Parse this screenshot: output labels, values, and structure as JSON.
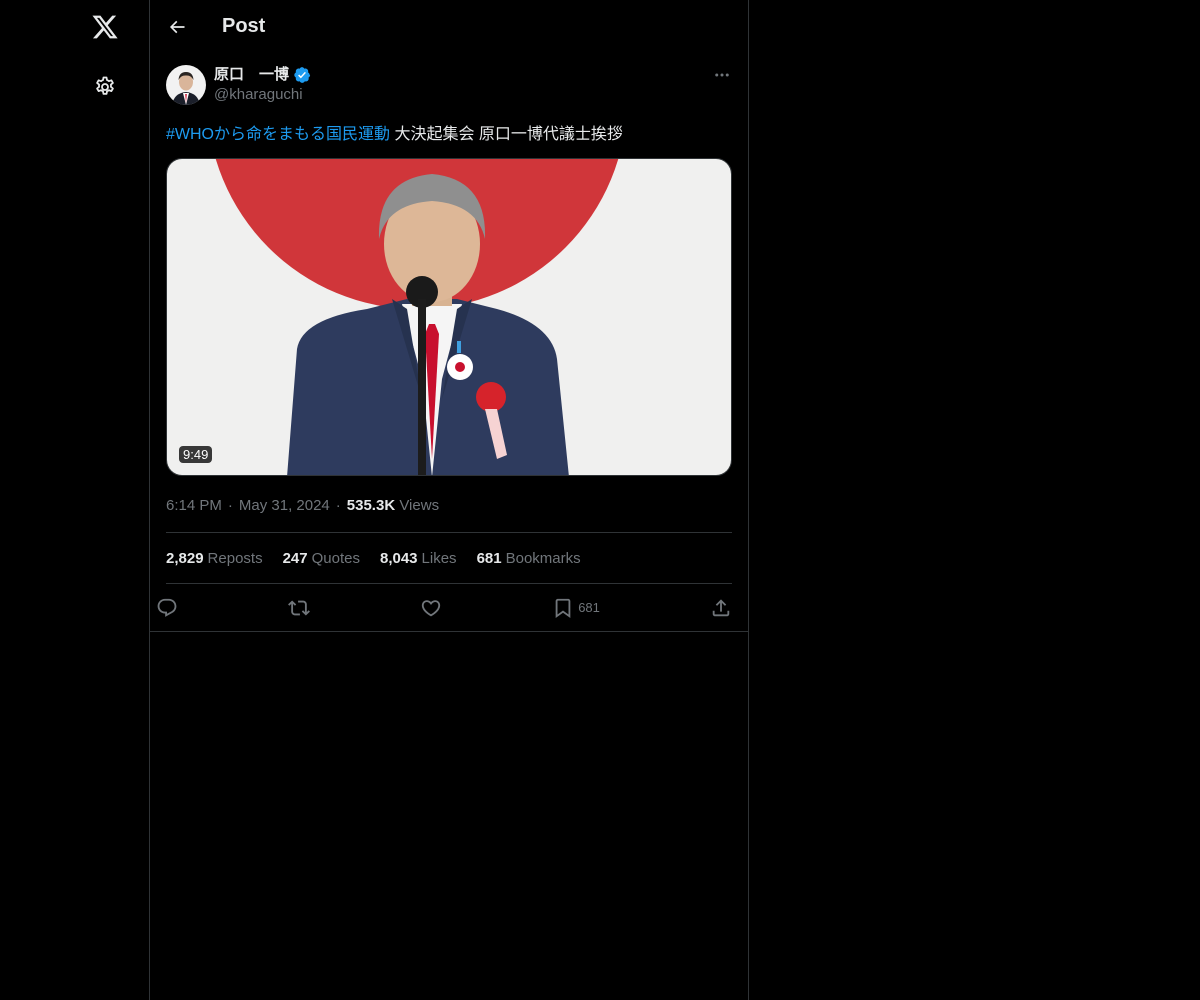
{
  "header": {
    "title": "Post"
  },
  "author": {
    "display_name": "原口　一博",
    "handle": "@kharaguchi"
  },
  "post": {
    "hashtag": "#WHOから命をまもる国民運動",
    "text": " 大決起集会 原口一博代議士挨拶",
    "video_duration": "9:49"
  },
  "meta": {
    "time": "6:14 PM",
    "separator": "·",
    "date": "May 31, 2024",
    "views_count": "535.3K",
    "views_label": "Views"
  },
  "stats": [
    {
      "count": "2,829",
      "label": "Reposts"
    },
    {
      "count": "247",
      "label": "Quotes"
    },
    {
      "count": "8,043",
      "label": "Likes"
    },
    {
      "count": "681",
      "label": "Bookmarks"
    }
  ],
  "actions": {
    "bookmark_count": "681"
  },
  "colors": {
    "background": "#000000",
    "border": "#2f3336",
    "text_primary": "#e7e9ea",
    "text_secondary": "#71767b",
    "accent": "#1d9bf0"
  },
  "icons": {
    "logo": "x-logo-icon",
    "settings": "gear-icon",
    "back": "arrow-left-icon",
    "verified": "verified-badge-icon",
    "more": "more-horizontal-icon",
    "reply": "reply-icon",
    "repost": "repost-icon",
    "like": "heart-icon",
    "bookmark": "bookmark-icon",
    "share": "share-icon"
  }
}
